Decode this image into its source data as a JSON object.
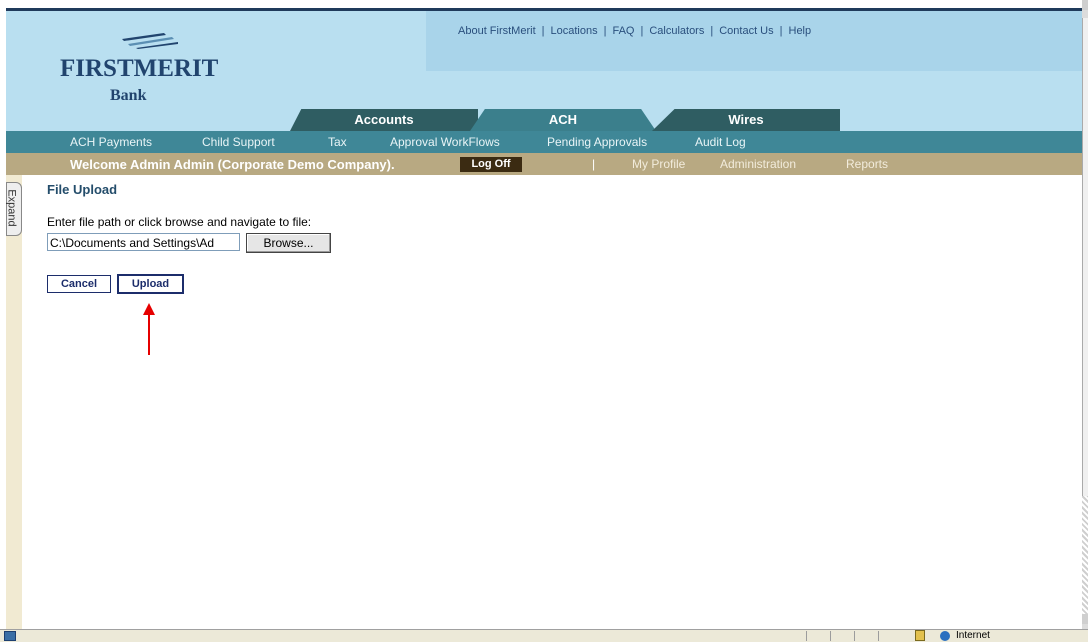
{
  "header": {
    "logo": {
      "name": "FIRSTMERIT",
      "sub": "Bank"
    },
    "util_links": [
      "About FirstMerit",
      "Locations",
      "FAQ",
      "Calculators",
      "Contact Us",
      "Help"
    ]
  },
  "tabs": [
    {
      "label": "Accounts"
    },
    {
      "label": "ACH",
      "active": true
    },
    {
      "label": "Wires"
    }
  ],
  "subnav": [
    "ACH Payments",
    "Child Support",
    "Tax",
    "Approval WorkFlows",
    "Pending Approvals",
    "Audit Log"
  ],
  "welcome": {
    "message": "Welcome Admin Admin (Corporate Demo Company).",
    "logoff": "Log Off",
    "separator": "|",
    "links": [
      "My Profile",
      "Administration",
      "Reports"
    ]
  },
  "sidebar": {
    "expand_label": "Expand"
  },
  "main": {
    "title": "File Upload",
    "instruction": "Enter file path or click browse and navigate to file:",
    "file_path_value": "C:\\Documents and Settings\\Ad",
    "browse_label": "Browse...",
    "cancel_label": "Cancel",
    "upload_label": "Upload"
  },
  "status_bar": {
    "zone": "Internet"
  },
  "colors": {
    "header_bg": "#b9dff0",
    "tab_dark": "#2f5d62",
    "tab_active": "#3b7f8c",
    "subnav_bg": "#3f8797",
    "welcome_bg": "#b8a982",
    "logo_text": "#21446e",
    "arrow": "#e60000"
  }
}
